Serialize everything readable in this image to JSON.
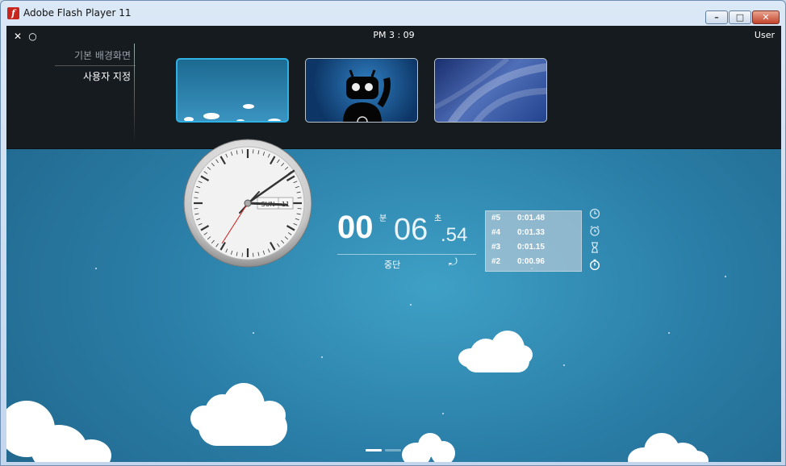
{
  "window": {
    "title": "Adobe Flash Player 11",
    "controls": {
      "minimize": "–",
      "maximize": "□",
      "close": "✕"
    }
  },
  "topbar": {
    "close_icon": "✕",
    "settings_icon": "○",
    "time": "PM 3 : 09",
    "user": "User"
  },
  "menu": {
    "items": [
      {
        "label": "기본 배경화면"
      },
      {
        "label": "사용자 지정"
      }
    ]
  },
  "thumbnails": [
    "clouds-sky",
    "robot-mascot",
    "blue-waves"
  ],
  "clock": {
    "date_day": "SUN",
    "date_num": "11"
  },
  "stopwatch": {
    "minutes": "00",
    "minutes_unit": "분",
    "seconds": "06",
    "seconds_unit": "초",
    "hundredths": ".54",
    "stop_label": "중단",
    "reset_icon": "⤾"
  },
  "laps": [
    {
      "num": "#5",
      "time": "0:01.48"
    },
    {
      "num": "#4",
      "time": "0:01.33"
    },
    {
      "num": "#3",
      "time": "0:01.15"
    },
    {
      "num": "#2",
      "time": "0:00.96"
    }
  ],
  "side_icons": [
    "clock-icon",
    "alarm-icon",
    "hourglass-icon",
    "stopwatch-icon"
  ]
}
